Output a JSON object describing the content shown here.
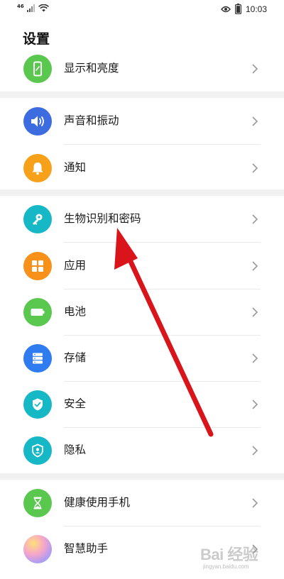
{
  "status_bar": {
    "network_label": "46",
    "time": "10:03"
  },
  "header": {
    "title": "设置"
  },
  "settings": {
    "display": {
      "label": "显示和亮度",
      "icon": "phone-display-icon",
      "color": "#5ac84e"
    },
    "sound": {
      "label": "声音和振动",
      "icon": "speaker-icon",
      "color": "#3d6be0"
    },
    "notifications": {
      "label": "通知",
      "icon": "bell-icon",
      "color": "#f7a11a"
    },
    "biometrics": {
      "label": "生物识别和密码",
      "icon": "key-icon",
      "color": "#17b8c6"
    },
    "apps": {
      "label": "应用",
      "icon": "apps-grid-icon",
      "color": "#f7911a"
    },
    "battery": {
      "label": "电池",
      "icon": "battery-icon",
      "color": "#5ac84e"
    },
    "storage": {
      "label": "存储",
      "icon": "storage-icon",
      "color": "#2f7cf0"
    },
    "security": {
      "label": "安全",
      "icon": "shield-check-icon",
      "color": "#17b8c6"
    },
    "privacy": {
      "label": "隐私",
      "icon": "privacy-shield-icon",
      "color": "#17b8c6"
    },
    "digital_health": {
      "label": "健康使用手机",
      "icon": "hourglass-icon",
      "color": "#5ac84e"
    },
    "assistant": {
      "label": "智慧助手",
      "icon": "smart-assistant-icon",
      "color": "#e887c4"
    }
  },
  "watermark": {
    "logo_text": "Bai 经验",
    "sub_text": "jingyan.baidu.com"
  },
  "annotation": {
    "arrow_color": "#d9141a",
    "points_to": "生物识别和密码"
  }
}
